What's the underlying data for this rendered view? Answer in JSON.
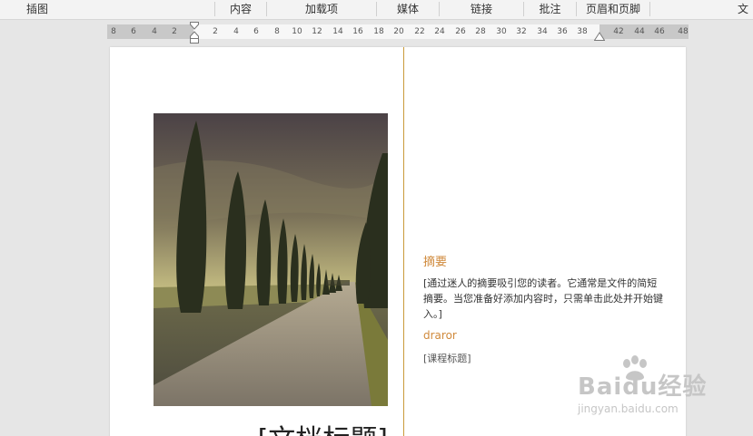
{
  "ribbon": {
    "groups": [
      "插图",
      "内容",
      "加载项",
      "媒体",
      "链接",
      "批注",
      "页眉和页脚",
      "文"
    ]
  },
  "ruler": {
    "left_ticks": [
      "8",
      "6",
      "4",
      "2"
    ],
    "right_ticks": [
      "2",
      "4",
      "6",
      "8",
      "10",
      "12",
      "14",
      "16",
      "18",
      "20",
      "22",
      "24",
      "26",
      "28",
      "30",
      "32",
      "34",
      "36",
      "38",
      "42",
      "44",
      "46",
      "48"
    ]
  },
  "document": {
    "title": "[文档标题]",
    "abstract_heading": "摘要",
    "abstract_body": "[通过迷人的摘要吸引您的读者。它通常是文件的简短摘要。当您准备好添加内容时，只需单击此处并开始键入。]",
    "author": "draror",
    "course_title": "[课程标题]"
  },
  "watermark": {
    "main": "Baidu经验",
    "sub": "jingyan.baidu.com"
  },
  "colors": {
    "accent": "#d08a3c",
    "column_rule": "#c99a3a",
    "ruler_margin": "#c8c8c8"
  }
}
